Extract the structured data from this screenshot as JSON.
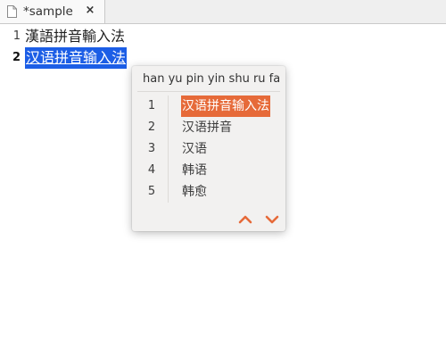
{
  "tab": {
    "title": "*sample",
    "close_glyph": "×",
    "doc_icon": "document-icon"
  },
  "editor": {
    "lines": [
      {
        "number": "1",
        "text": "漢語拼音輸入法"
      },
      {
        "number": "2",
        "text": "汉语拼音输入法"
      }
    ]
  },
  "ime": {
    "preedit_pinyin": "han yu pin yin shu ru fa›",
    "candidates": [
      {
        "index": "1",
        "text": "汉语拼音输入法"
      },
      {
        "index": "2",
        "text": "汉语拼音"
      },
      {
        "index": "3",
        "text": "汉语"
      },
      {
        "index": "4",
        "text": "韩语"
      },
      {
        "index": "5",
        "text": "韩愈"
      }
    ],
    "selected_index": 0,
    "page_up_icon": "chevron-up-icon",
    "page_down_icon": "chevron-down-icon"
  },
  "colors": {
    "selection_blue": "#1c5ee6",
    "candidate_highlight": "#e66a39",
    "pager_arrow": "#e66a39",
    "popup_background": "#f2f1f0"
  }
}
